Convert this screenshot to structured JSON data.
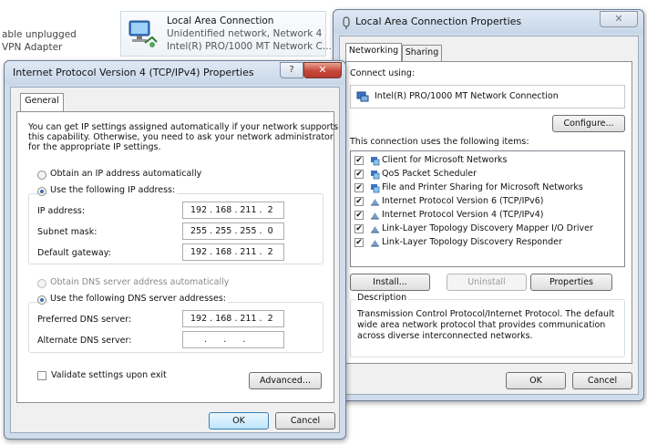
{
  "background": {
    "left_text_1": "able unplugged",
    "left_text_2": "VPN Adapter",
    "tile": {
      "name": "Local Area Connection",
      "status": "Unidentified network, Network 4",
      "adapter": "Intel(R) PRO/1000 MT Network C..."
    }
  },
  "lac_props": {
    "title": "Local Area Connection Properties",
    "tabs": [
      "Networking",
      "Sharing"
    ],
    "connect_using_label": "Connect using:",
    "adapter_name": "Intel(R) PRO/1000 MT Network Connection",
    "configure_label": "Configure...",
    "items_label": "This connection uses the following items:",
    "items": [
      {
        "label": "Client for Microsoft Networks",
        "checked": true,
        "icon": "network-client-icon"
      },
      {
        "label": "QoS Packet Scheduler",
        "checked": true,
        "icon": "qos-scheduler-icon"
      },
      {
        "label": "File and Printer Sharing for Microsoft Networks",
        "checked": true,
        "icon": "file-printer-sharing-icon"
      },
      {
        "label": "Internet Protocol Version 6 (TCP/IPv6)",
        "checked": true,
        "icon": "protocol-icon"
      },
      {
        "label": "Internet Protocol Version 4 (TCP/IPv4)",
        "checked": true,
        "icon": "protocol-icon"
      },
      {
        "label": "Link-Layer Topology Discovery Mapper I/O Driver",
        "checked": true,
        "icon": "protocol-icon"
      },
      {
        "label": "Link-Layer Topology Discovery Responder",
        "checked": true,
        "icon": "protocol-icon"
      }
    ],
    "install_label": "Install...",
    "uninstall_label": "Uninstall",
    "properties_label": "Properties",
    "description_label": "Description",
    "description_text_1": "Transmission Control Protocol/Internet Protocol. The default",
    "description_text_2": "wide area network protocol that provides communication",
    "description_text_3": "across diverse interconnected networks.",
    "ok_label": "OK",
    "cancel_label": "Cancel",
    "close_glyph": "✕"
  },
  "ipv4_props": {
    "title": "Internet Protocol Version 4 (TCP/IPv4) Properties",
    "help_glyph": "?",
    "close_glyph": "✕",
    "tab_general": "General",
    "intro_1": "You can get IP settings assigned automatically if your network supports",
    "intro_2": "this capability. Otherwise, you need to ask your network administrator",
    "intro_3": "for the appropriate IP settings.",
    "obtain_ip_auto": "Obtain an IP address automatically",
    "use_following_ip": "Use the following IP address:",
    "ip_address_label": "IP address:",
    "ip_address_value": "192 . 168 . 211 .  2",
    "subnet_label": "Subnet mask:",
    "subnet_value": "255 . 255 . 255 .  0",
    "gateway_label": "Default gateway:",
    "gateway_value": "192 . 168 . 211 .  2",
    "obtain_dns_auto": "Obtain DNS server address automatically",
    "use_following_dns": "Use the following DNS server addresses:",
    "preferred_dns_label": "Preferred DNS server:",
    "preferred_dns_value": "192 . 168 . 211 .  2",
    "alternate_dns_label": "Alternate DNS server:",
    "alternate_dns_value": "     .      .      .",
    "validate_label": "Validate settings upon exit",
    "advanced_label": "Advanced...",
    "ok_label": "OK",
    "cancel_label": "Cancel"
  },
  "colors": {
    "title_bar": "#c7d6e8",
    "close_button": "#c8463a",
    "default_button": "#bee6fd"
  }
}
